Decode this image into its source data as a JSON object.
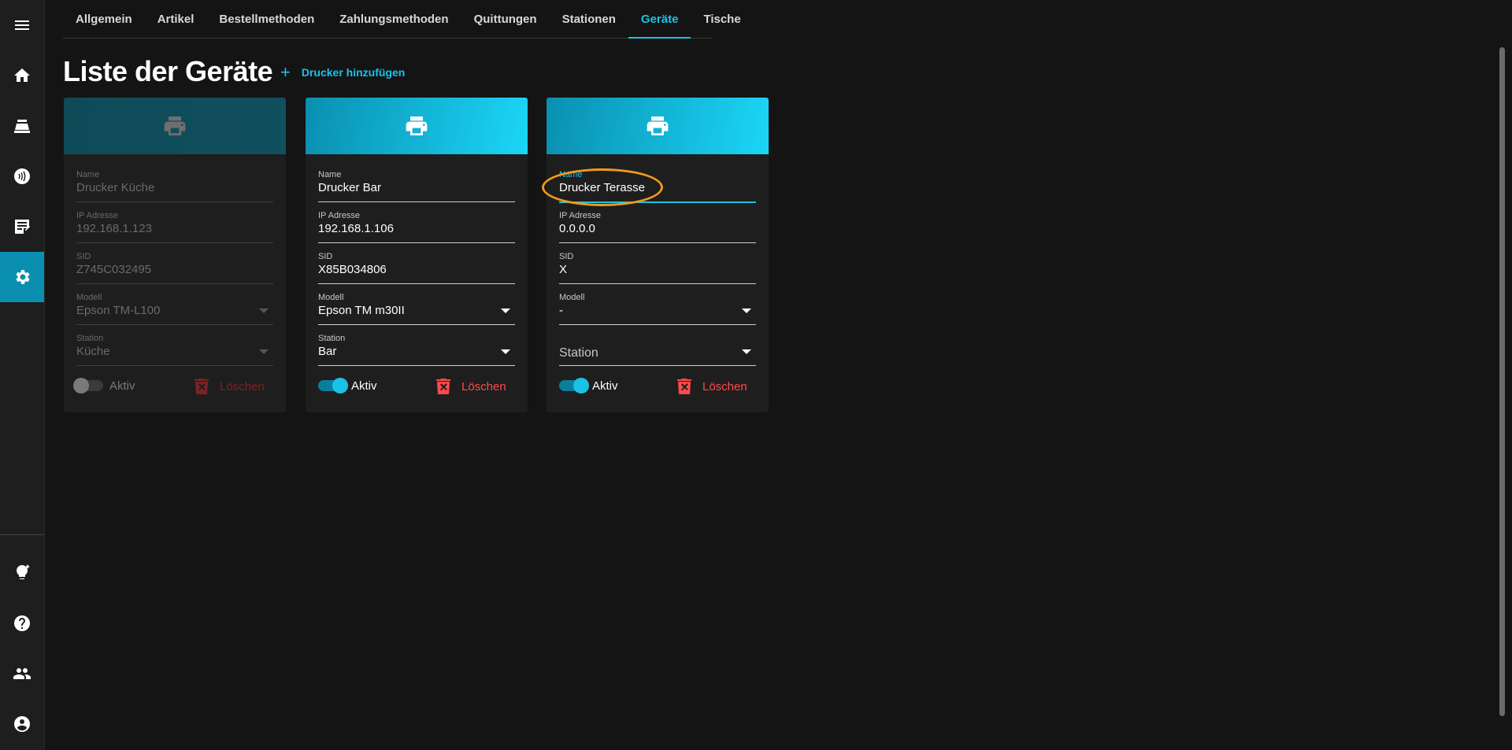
{
  "sidebar": {
    "items": [
      {
        "icon": "menu-icon"
      },
      {
        "icon": "home-icon"
      },
      {
        "icon": "cash-register-icon"
      },
      {
        "icon": "contactless-icon"
      },
      {
        "icon": "receipt-edit-icon"
      },
      {
        "icon": "settings-icon",
        "active": true
      },
      {
        "icon": "lightbulb-icon"
      },
      {
        "icon": "help-icon"
      },
      {
        "icon": "users-icon"
      },
      {
        "icon": "account-icon"
      }
    ]
  },
  "tabs": [
    "Allgemein",
    "Artikel",
    "Bestellmethoden",
    "Zahlungsmethoden",
    "Quittungen",
    "Stationen",
    "Geräte",
    "Tische"
  ],
  "active_tab": "Geräte",
  "page": {
    "title": "Liste der Geräte",
    "add_label": "Drucker hinzufügen"
  },
  "labels": {
    "name": "Name",
    "ip": "IP Adresse",
    "sid": "SID",
    "model": "Modell",
    "station": "Station",
    "active": "Aktiv",
    "delete": "Löschen"
  },
  "devices": [
    {
      "name": "Drucker Küche",
      "ip": "192.168.1.123",
      "sid": "Z745C032495",
      "model": "Epson TM-L100",
      "station": "Küche",
      "active": false
    },
    {
      "name": "Drucker Bar",
      "ip": "192.168.1.106",
      "sid": "X85B034806",
      "model": "Epson TM m30II",
      "station": "Bar",
      "active": true
    },
    {
      "name": "Drucker Terasse",
      "ip": "0.0.0.0",
      "sid": "X",
      "model": "-",
      "station": "",
      "active": true
    }
  ],
  "colors": {
    "accent": "#19c3e6",
    "danger": "#ff4a4a",
    "highlight": "#f19a1a"
  }
}
